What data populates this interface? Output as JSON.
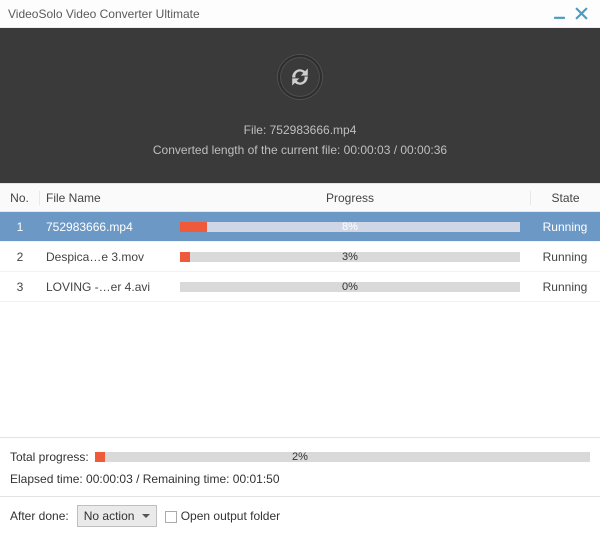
{
  "titlebar": {
    "title": "VideoSolo Video Converter Ultimate"
  },
  "status": {
    "file_line": "File: 752983666.mp4",
    "length_line": "Converted length of the current file: 00:00:03 / 00:00:36"
  },
  "columns": {
    "no": "No.",
    "name": "File Name",
    "progress": "Progress",
    "state": "State"
  },
  "rows": [
    {
      "no": "1",
      "name": "752983666.mp4",
      "pct_label": "8%",
      "pct": 8,
      "state": "Running",
      "selected": true
    },
    {
      "no": "2",
      "name": "Despica…e 3.mov",
      "pct_label": "3%",
      "pct": 3,
      "state": "Running",
      "selected": false
    },
    {
      "no": "3",
      "name": "LOVING -…er 4.avi",
      "pct_label": "0%",
      "pct": 0,
      "state": "Running",
      "selected": false
    }
  ],
  "totals": {
    "label": "Total progress:",
    "pct_label": "2%",
    "pct": 2,
    "time_line": "Elapsed time: 00:00:03 / Remaining time: 00:01:50"
  },
  "footer": {
    "after_done_label": "After done:",
    "after_done_value": "No action",
    "open_folder_label": "Open output folder"
  }
}
